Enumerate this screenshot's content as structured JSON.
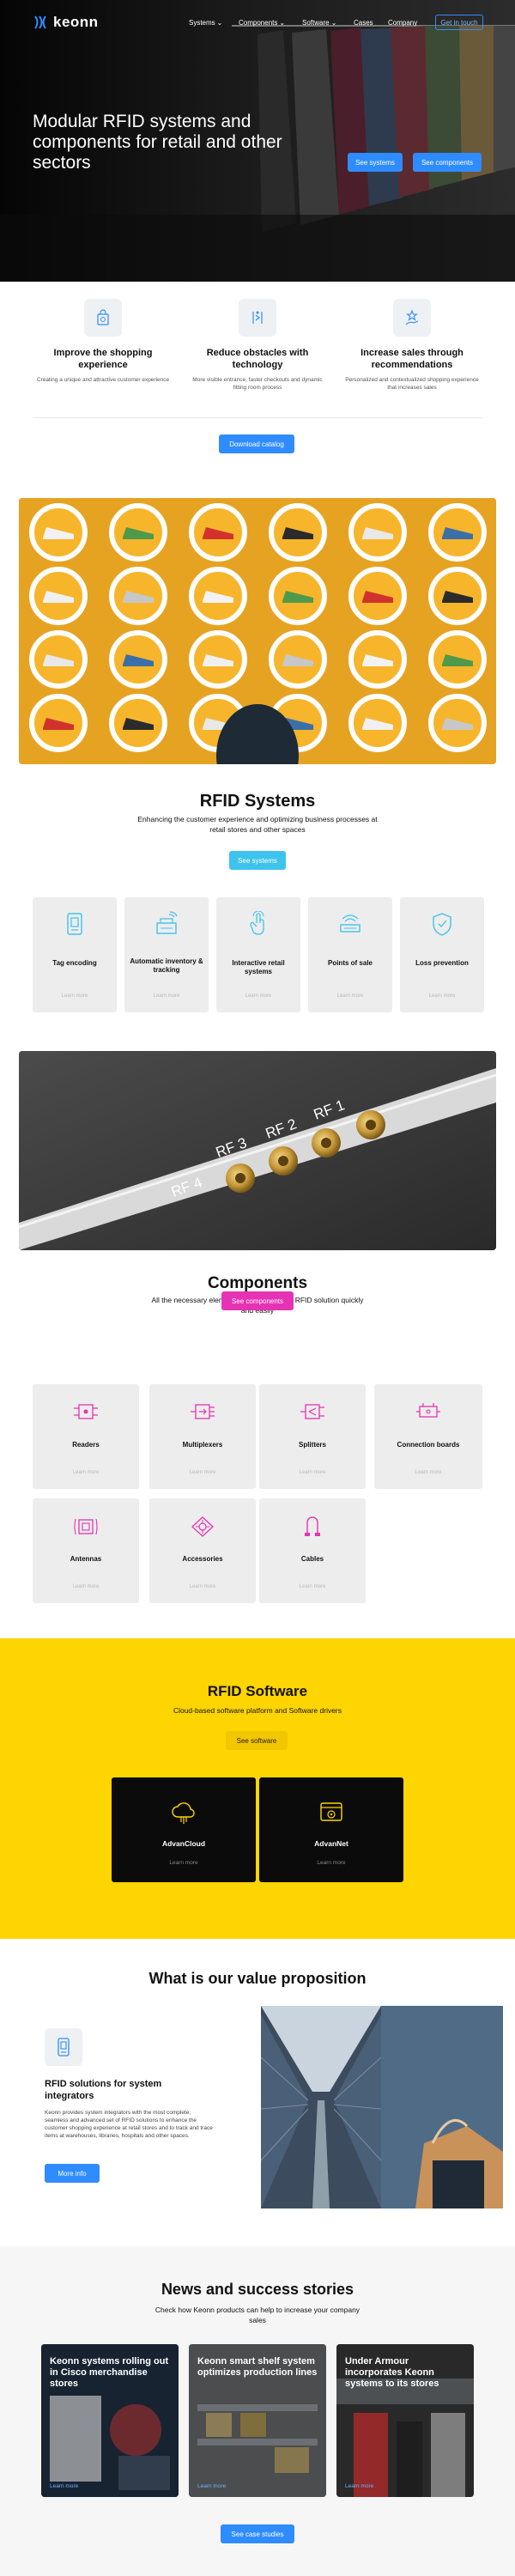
{
  "brand": "keonn",
  "nav": {
    "items": [
      "Systems",
      "Components",
      "Software",
      "Cases",
      "Company"
    ],
    "cta": "Get in touch"
  },
  "hero": {
    "title": "Modular RFID systems and components for retail and other sectors",
    "btn_systems": "See systems",
    "btn_components": "See components"
  },
  "features": [
    {
      "title": "Improve the shopping experience",
      "desc": "Creating a unique and attractive customer experience"
    },
    {
      "title": "Reduce obstacles with technology",
      "desc": "More visible entrance, faster checkouts and dynamic fitting room process"
    },
    {
      "title": "Increase sales through recommendations",
      "desc": "Personalized and contextualized shopping experience that increases sales"
    }
  ],
  "catalog_btn": "Download catalog",
  "rfid_systems": {
    "title": "RFID Systems",
    "subtitle": "Enhancing the customer experience and optimizing business processes at retail stores and other spaces",
    "btn": "See systems",
    "cards": [
      {
        "title": "Tag encoding",
        "link": "Learn more"
      },
      {
        "title": "Automatic inventory & tracking",
        "link": "Learn more"
      },
      {
        "title": "Interactive retail systems",
        "link": "Learn more"
      },
      {
        "title": "Points of sale",
        "link": "Learn more"
      },
      {
        "title": "Loss prevention",
        "link": "Learn more"
      }
    ]
  },
  "cable_ports": [
    "RF 4",
    "RF 3",
    "RF 2",
    "RF 1"
  ],
  "components": {
    "title": "Components",
    "subtitle": "All the necessary elements for setting up an RFID solution quickly and easily",
    "btn": "See components",
    "cards": [
      {
        "title": "Readers",
        "link": "Learn more"
      },
      {
        "title": "Multiplexers",
        "link": "Learn more"
      },
      {
        "title": "Splitters",
        "link": "Learn more"
      },
      {
        "title": "Connection boards",
        "link": "Learn more"
      },
      {
        "title": "Antennas",
        "link": "Learn more"
      },
      {
        "title": "Accessories",
        "link": "Learn more"
      },
      {
        "title": "Cables",
        "link": "Learn more"
      }
    ]
  },
  "software": {
    "title": "RFID Software",
    "subtitle": "Cloud-based software platform and Software drivers",
    "btn": "See software",
    "cards": [
      {
        "title": "AdvanCloud",
        "link": "Learn more"
      },
      {
        "title": "AdvanNet",
        "link": "Learn more"
      }
    ]
  },
  "value": {
    "title": "What is our value proposition",
    "item_title": "RFID solutions for system integrators",
    "item_desc": "Keonn provides system integrators with the most complete, seamless and advanced set of RFID solutions to enhance the customer shopping experience at retail stores and to track and trace items at warehouses, libraries, hospitals and other spaces.",
    "btn": "More info"
  },
  "news": {
    "title": "News and success stories",
    "subtitle": "Check how Keonn products can help to increase your company sales",
    "cards": [
      {
        "title": "Keonn systems rolling out in Cisco merchandise stores",
        "link": "Learn more"
      },
      {
        "title": "Keonn smart shelf system optimizes production lines",
        "link": "Learn more"
      },
      {
        "title": "Under Armour incorporates Keonn systems to its stores",
        "link": "Learn more"
      }
    ],
    "btn": "See case studies"
  },
  "colors": {
    "blue": "#2f8cff",
    "cyan": "#3ec3ec",
    "magenta": "#e632b4",
    "yellow": "#ffd500"
  }
}
